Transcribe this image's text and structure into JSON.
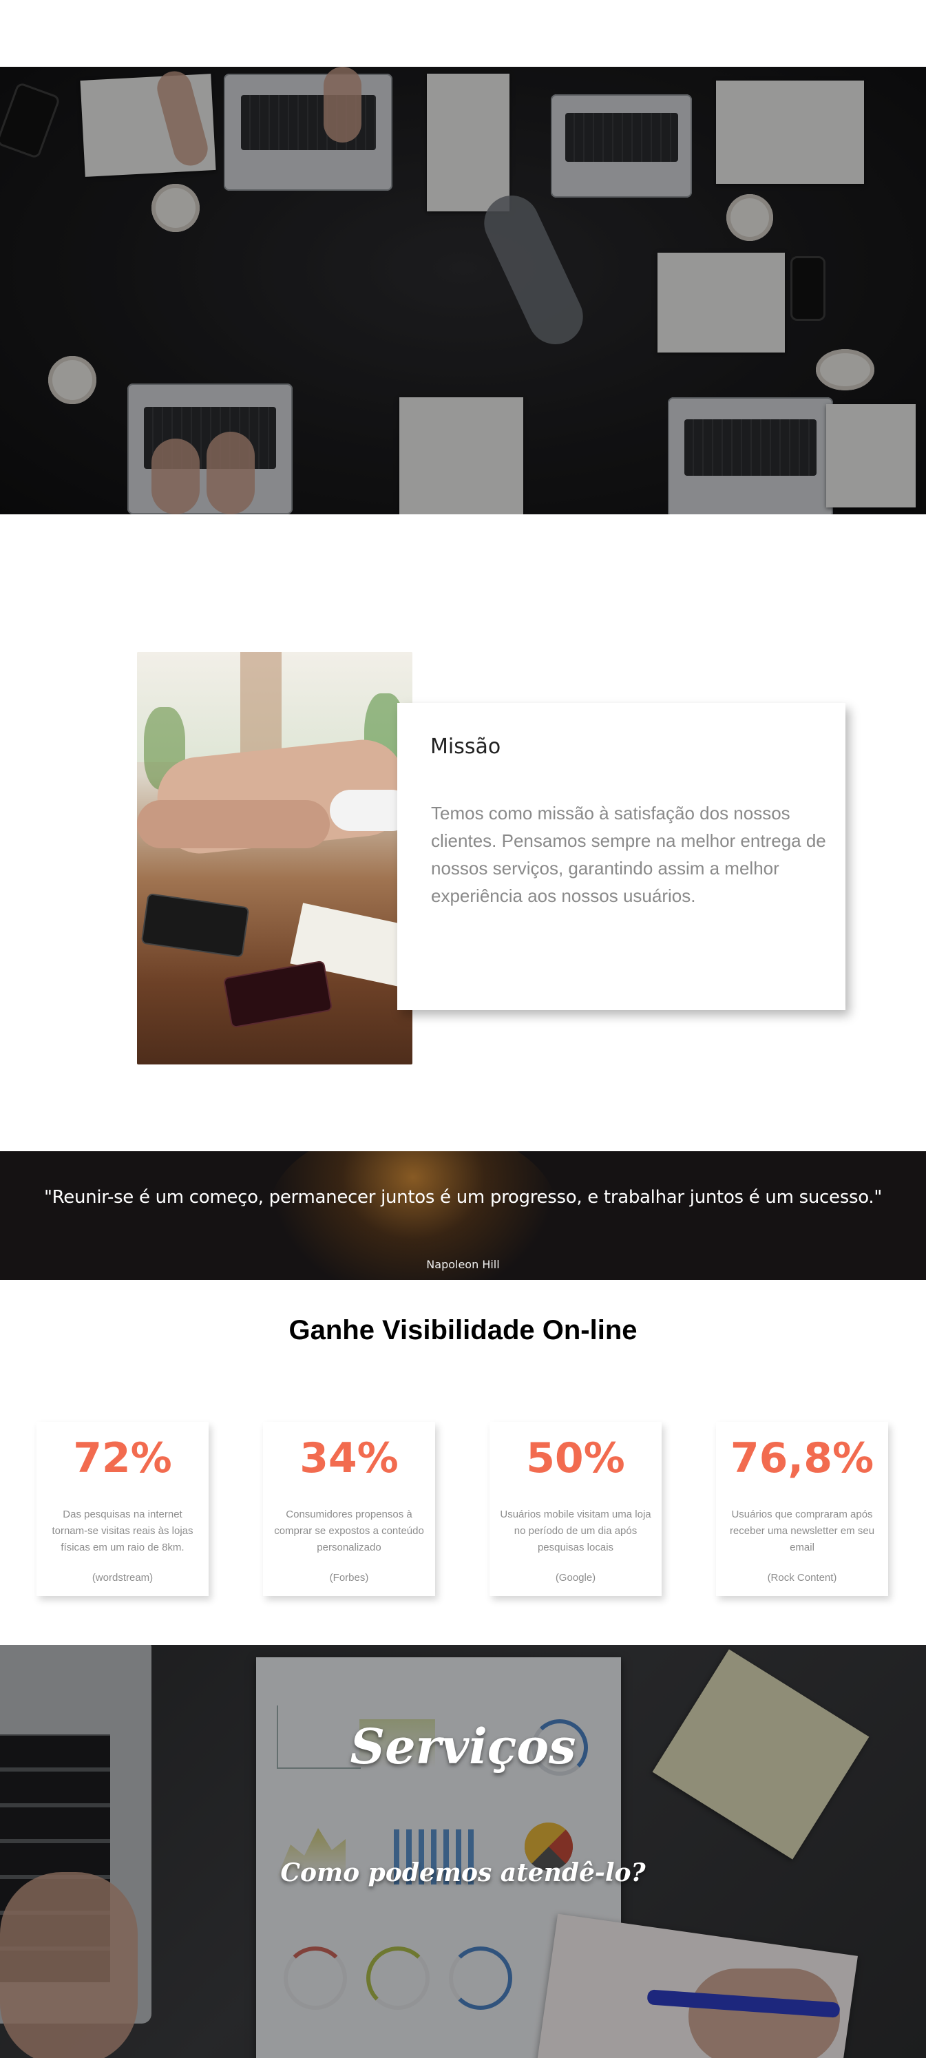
{
  "mission": {
    "title": "Missão",
    "text": "Temos como missão à satisfação dos nossos clientes. Pensamos sempre na melhor entrega de nossos serviços, garantindo assim a melhor experiência aos nossos usuários."
  },
  "quote": {
    "text": "\"Reunir-se é um começo, permanecer juntos é um progresso, e trabalhar juntos é um sucesso.\"",
    "author": "Napoleon Hill"
  },
  "stats": {
    "heading": "Ganhe Visibilidade On-line",
    "items": [
      {
        "value": "72%",
        "description": "Das pesquisas na internet tornam-se visitas reais às lojas físicas em um raio de 8km.",
        "source": "(wordstream)"
      },
      {
        "value": "34%",
        "description": "Consumidores propensos à comprar se expostos a conteúdo personalizado",
        "source": "(Forbes)"
      },
      {
        "value": "50%",
        "description": "Usuários mobile visitam uma loja no período de um dia após pesquisas locais",
        "source": "(Google)"
      },
      {
        "value": "76,8%",
        "description": "Usuários que compraram após receber uma newsletter em seu email",
        "source": "(Rock Content)"
      }
    ]
  },
  "services": {
    "title": "Serviços",
    "subtitle": "Como podemos atendê-lo?"
  },
  "colors": {
    "accent": "#f26b4f",
    "quote_band": "#151213",
    "text_muted": "#8a8a8a"
  }
}
